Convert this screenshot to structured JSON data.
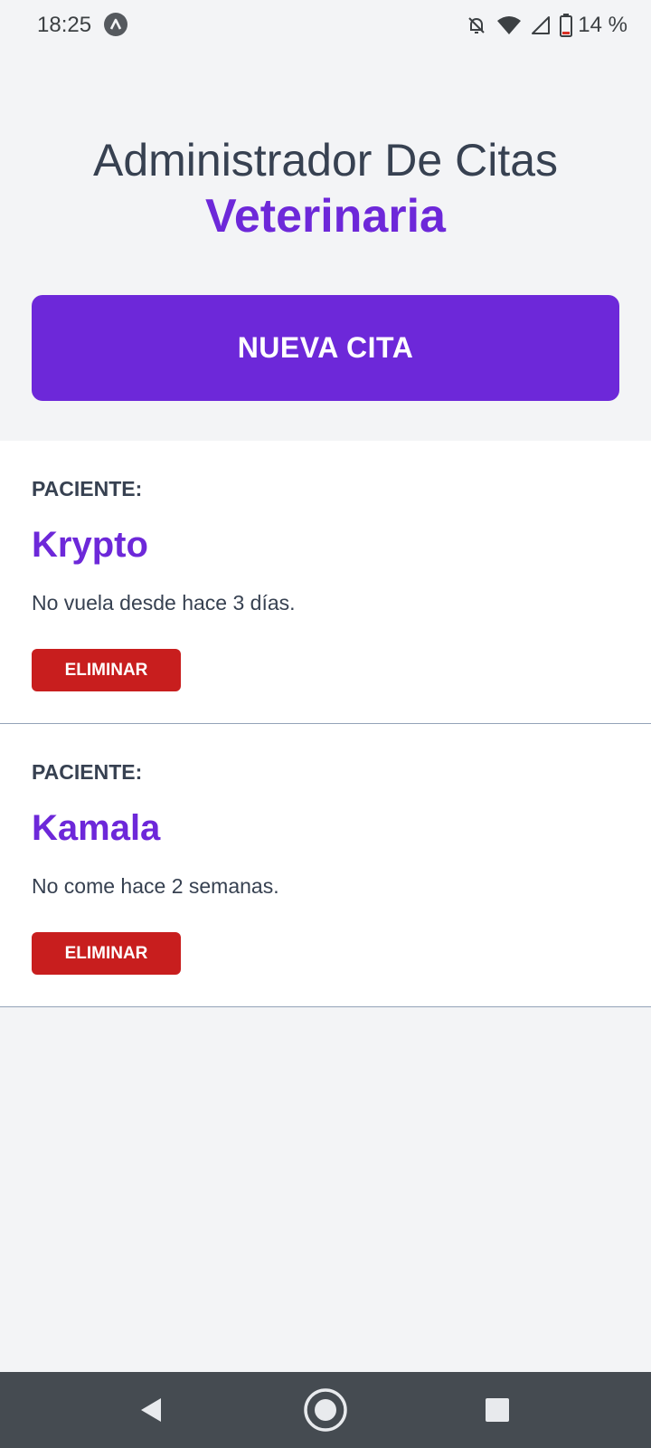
{
  "status_bar": {
    "time": "18:25",
    "battery": "14 %",
    "icons": [
      "app-notification-icon",
      "bell-off-icon",
      "wifi-icon",
      "signal-icon",
      "battery-icon"
    ]
  },
  "header": {
    "title_line1": "Administrador De Citas",
    "title_line2": "Veterinaria"
  },
  "new_appointment_button": "NUEVA CITA",
  "patients": [
    {
      "label": "PACIENTE:",
      "name": "Krypto",
      "description": "No vuela desde hace 3 días.",
      "delete_label": "ELIMINAR"
    },
    {
      "label": "PACIENTE:",
      "name": "Kamala",
      "description": "No come hace 2 semanas.",
      "delete_label": "ELIMINAR"
    }
  ],
  "nav_bar": {
    "icons": [
      "back-icon",
      "home-icon",
      "recents-icon"
    ]
  },
  "colors": {
    "accent": "#6d28d9",
    "danger": "#c81e1e",
    "text": "#374151",
    "background": "#f3f4f6",
    "nav_bar": "#454b51"
  }
}
